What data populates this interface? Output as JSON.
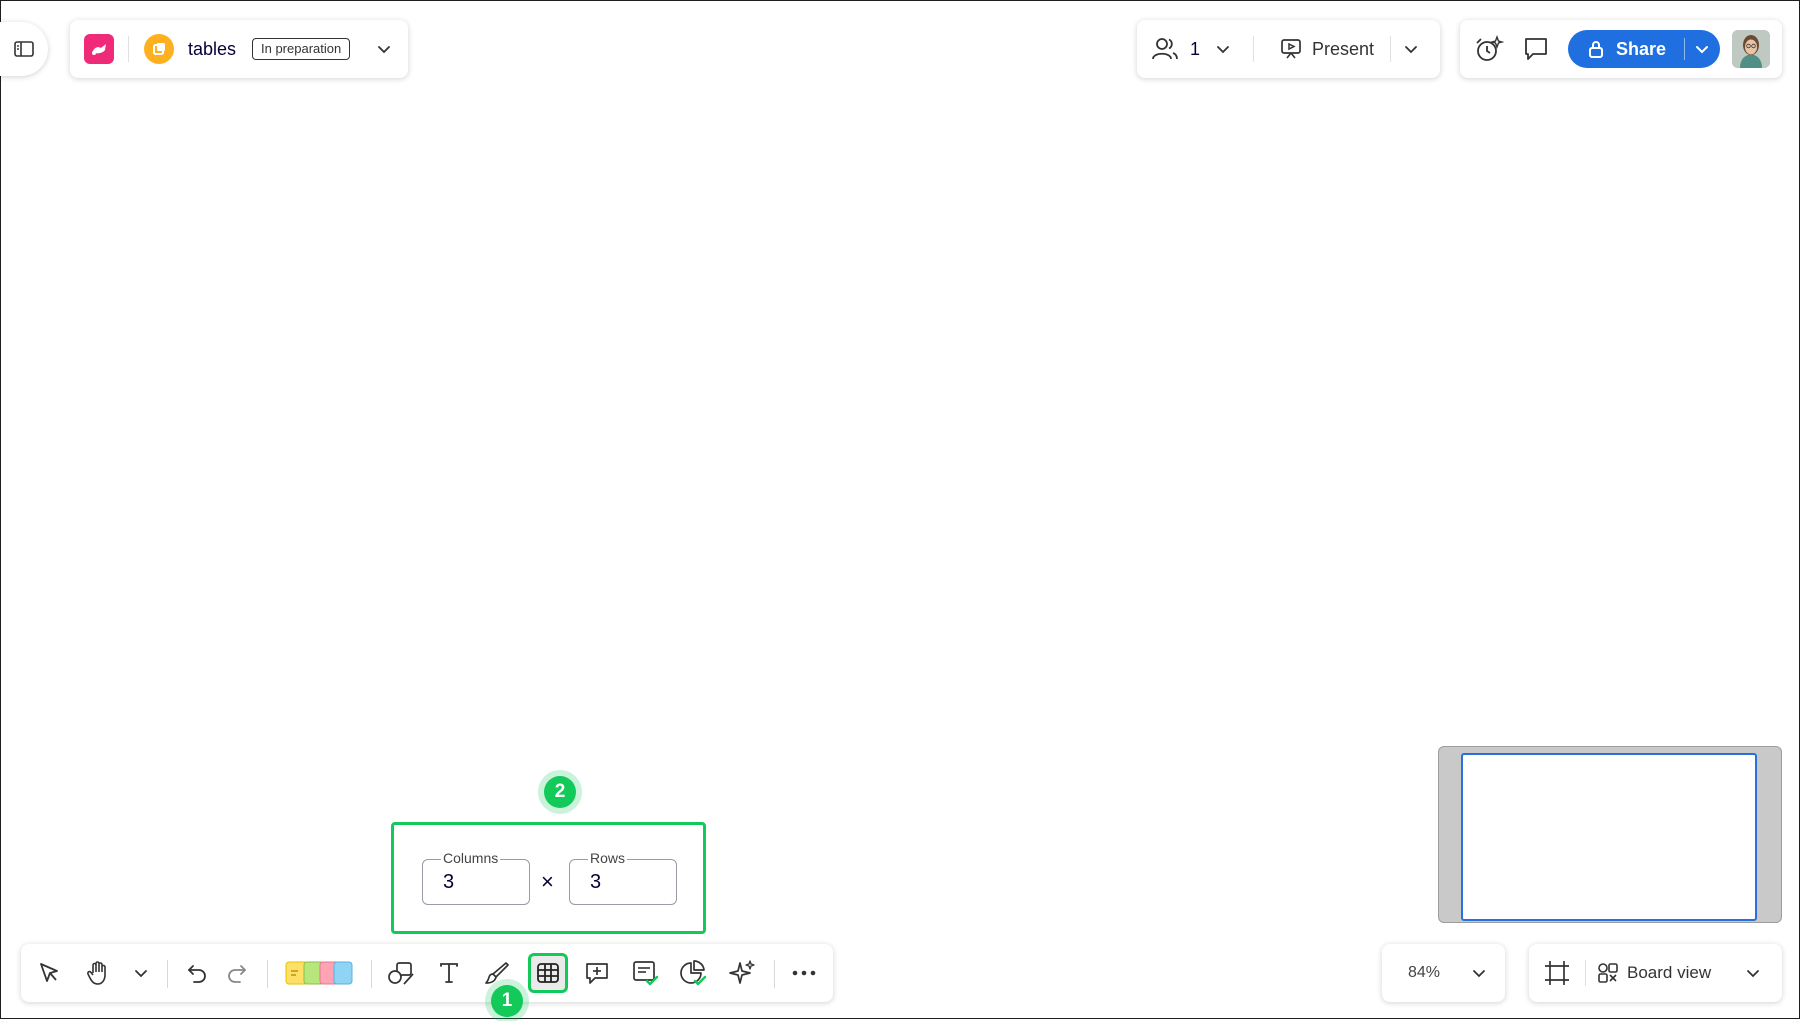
{
  "board": {
    "name": "tables",
    "status": "In preparation"
  },
  "collab": {
    "participants_count": "1",
    "present_label": "Present"
  },
  "share": {
    "label": "Share"
  },
  "table_popup": {
    "columns_label": "Columns",
    "columns_value": "3",
    "times_symbol": "×",
    "rows_label": "Rows",
    "rows_value": "3"
  },
  "callouts": {
    "one": "1",
    "two": "2"
  },
  "zoom": {
    "level": "84%"
  },
  "view": {
    "label": "Board view"
  },
  "colors": {
    "accent_green": "#12c95a",
    "share_blue": "#1f6fe0",
    "logo_pink": "#ef2a78",
    "space_yellow": "#ffb020"
  },
  "toolbar": {
    "tools": [
      "select-icon",
      "hand-icon",
      "undo-icon",
      "redo-icon",
      "sticky-notes-icon",
      "shapes-icon",
      "text-icon",
      "pen-icon",
      "table-icon",
      "comment-icon",
      "card-icon",
      "chart-icon",
      "ai-sparkle-icon",
      "more-icon"
    ]
  }
}
